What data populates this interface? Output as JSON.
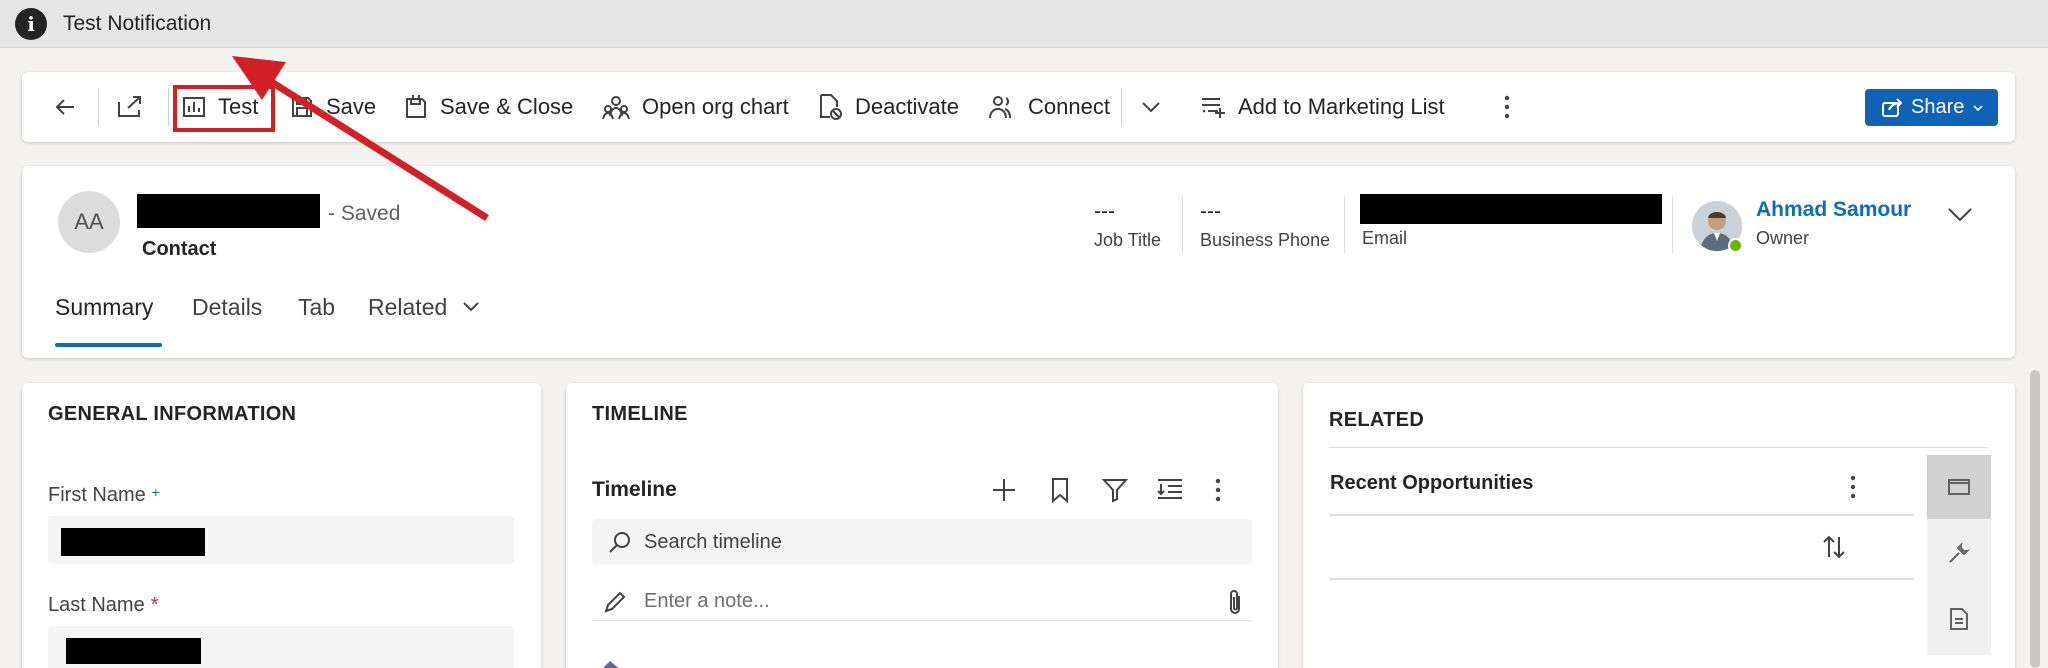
{
  "notification": {
    "icon": "info-icon",
    "text": "Test Notification"
  },
  "command_bar": {
    "test": "Test",
    "save": "Save",
    "save_close": "Save & Close",
    "open_org_chart": "Open org chart",
    "deactivate": "Deactivate",
    "connect": "Connect",
    "add_to_marketing_list": "Add to Marketing List",
    "share": "Share"
  },
  "header": {
    "avatar_initials": "AA",
    "saved_status": "- Saved",
    "entity": "Contact",
    "job_title_value": "---",
    "job_title_label": "Job Title",
    "business_phone_value": "---",
    "business_phone_label": "Business Phone",
    "email_label": "Email",
    "owner_name": "Ahmad Samour",
    "owner_label": "Owner"
  },
  "tabs": [
    "Summary",
    "Details",
    "Tab",
    "Related"
  ],
  "general_information": {
    "title": "GENERAL INFORMATION",
    "first_name_label": "First Name",
    "first_name_marker": "+",
    "last_name_label": "Last Name",
    "last_name_marker": "*"
  },
  "timeline": {
    "section_title": "TIMELINE",
    "header": "Timeline",
    "search_placeholder": "Search timeline",
    "note_placeholder": "Enter a note..."
  },
  "related": {
    "title": "RELATED",
    "recent_opportunities": "Recent Opportunities"
  },
  "colors": {
    "accent": "#0f6cbd",
    "highlight": "#d22027",
    "share_button": "#1062b4"
  }
}
